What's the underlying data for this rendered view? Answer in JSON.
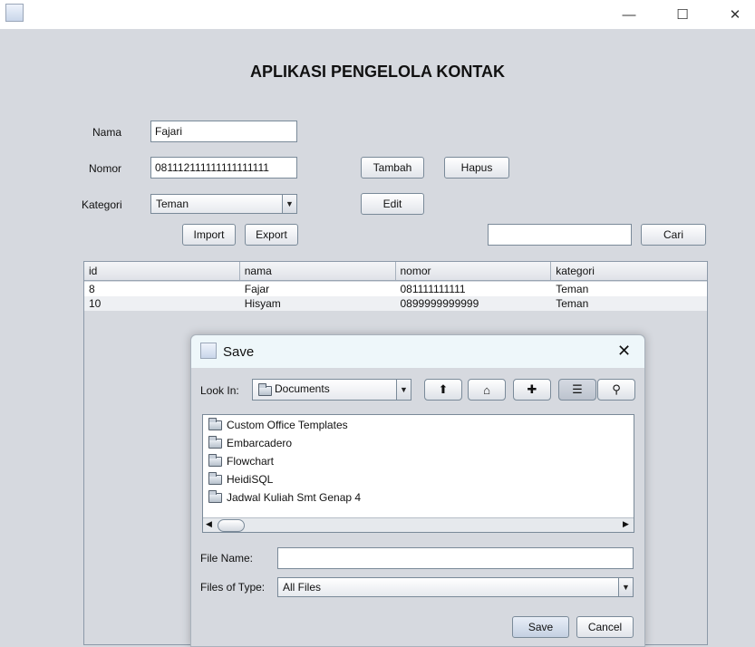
{
  "window": {
    "minimize": "—",
    "maximize": "☐",
    "close": "✕"
  },
  "heading": "APLIKASI PENGELOLA KONTAK",
  "form": {
    "nama_label": "Nama",
    "nama_value": "Fajari",
    "nomor_label": "Nomor",
    "nomor_value": "081112111111111111111",
    "kategori_label": "Kategori",
    "kategori_value": "Teman"
  },
  "buttons": {
    "tambah": "Tambah",
    "hapus": "Hapus",
    "edit": "Edit",
    "import": "Import",
    "export": "Export",
    "cari": "Cari"
  },
  "search": {
    "value": ""
  },
  "table": {
    "columns": [
      "id",
      "nama",
      "nomor",
      "kategori"
    ],
    "rows": [
      [
        "8",
        "Fajar",
        "081111111111",
        "Teman"
      ],
      [
        "10",
        "Hisyam",
        "0899999999999",
        "Teman"
      ]
    ]
  },
  "dialog": {
    "title": "Save",
    "look_in_label": "Look In:",
    "look_in_value": "Documents",
    "toolbar_icons": [
      "up-folder-icon",
      "home-icon",
      "new-folder-icon",
      "list-view-icon",
      "details-view-icon"
    ],
    "files": [
      "Custom Office Templates",
      "Embarcadero",
      "Flowchart",
      "HeidiSQL",
      "Jadwal Kuliah Smt Genap 4"
    ],
    "file_name_label": "File Name:",
    "file_name_value": "",
    "file_type_label": "Files of Type:",
    "file_type_value": "All Files",
    "save": "Save",
    "cancel": "Cancel"
  }
}
